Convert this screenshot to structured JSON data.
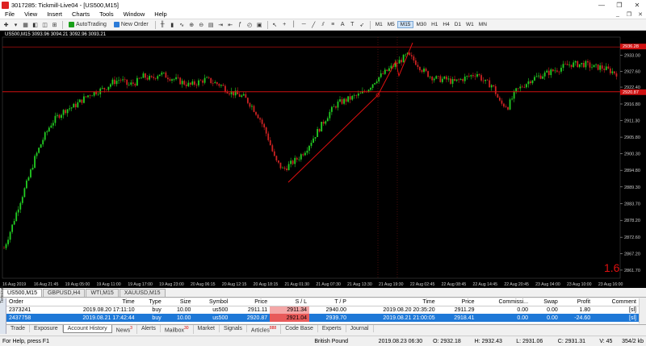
{
  "titlebar": {
    "title": "3017285: Tickmill-Live04 - [US500,M15]",
    "minimize": "—",
    "restore": "❐",
    "close": "✕"
  },
  "menu": {
    "items": [
      "File",
      "View",
      "Insert",
      "Charts",
      "Tools",
      "Window",
      "Help"
    ],
    "mdi": [
      "_",
      "❐",
      "✕"
    ]
  },
  "toolbar": {
    "autotrading": "AutoTrading",
    "neworder": "New Order",
    "timeframes": [
      "M1",
      "M5",
      "M15",
      "M30",
      "H1",
      "H4",
      "D1",
      "W1",
      "MN"
    ],
    "active_tf": "M15",
    "colors": {
      "autotrading": "#1aa01a",
      "neworder": "#2b7bd8"
    }
  },
  "chart": {
    "symbol_info": "US500,M15  3093.96 3094.21 3092.96 3093.21",
    "big_label": "1.6",
    "price_top": "2936.28",
    "price_line": "2920.87",
    "bg": "#000000",
    "bull": "#22cc22",
    "bear": "#cc2222",
    "chart_data": {
      "type": "line",
      "y_ticks": [
        "2933.00",
        "2927.60",
        "2922.40",
        "2916.80",
        "2911.30",
        "2905.80",
        "2900.30",
        "2894.80",
        "2889.30",
        "2883.70",
        "2878.20",
        "2872.60",
        "2867.20",
        "2861.70"
      ],
      "x_ticks": [
        "16 Aug 2019",
        "16 Aug 21:45",
        "19 Aug 05:00",
        "19 Aug 11:00",
        "19 Aug 17:00",
        "19 Aug 23:00",
        "20 Aug 06:15",
        "20 Aug 12:15",
        "20 Aug 18:15",
        "21 Aug 01:30",
        "21 Aug 07:30",
        "21 Aug 13:30",
        "21 Aug 19:30",
        "22 Aug 02:45",
        "22 Aug 08:45",
        "22 Aug 14:45",
        "22 Aug 20:45",
        "23 Aug 04:00",
        "23 Aug 10:00",
        "23 Aug 16:00"
      ],
      "ylim": [
        2859,
        2939
      ],
      "close_prices": [
        2869,
        2876,
        2884,
        2891,
        2899,
        2905,
        2910,
        2913,
        2915,
        2916,
        2918,
        2920,
        2921,
        2922,
        2924,
        2925,
        2923,
        2924,
        2926,
        2925,
        2927,
        2926,
        2925,
        2924,
        2923,
        2924,
        2925,
        2924,
        2923,
        2921,
        2920,
        2919,
        2916,
        2912,
        2906,
        2898,
        2895,
        2897,
        2899,
        2902,
        2906,
        2910,
        2914,
        2917,
        2918,
        2919,
        2920,
        2922,
        2925,
        2927,
        2929,
        2931,
        2933,
        2931,
        2928,
        2926,
        2925,
        2925,
        2924,
        2925,
        2926,
        2927,
        2924,
        2923,
        2917,
        2916,
        2921,
        2923,
        2925,
        2926,
        2927,
        2928,
        2929,
        2930,
        2930,
        2930,
        2929,
        2929,
        2928,
        2927
      ]
    }
  },
  "chart_tabs": {
    "items": [
      "US500,M15",
      "GBPUSD,H4",
      "WTI,M15",
      "XAUUSD,M15"
    ],
    "active": 0
  },
  "terminal": {
    "side_label": "Terminal",
    "columns": [
      "Order",
      "Time",
      "Type",
      "Size",
      "Symbol",
      "Price",
      "S / L",
      "T / P",
      "Time",
      "Price",
      "Commissi...",
      "Swap",
      "Profit",
      "Comment"
    ],
    "rows": [
      [
        "2373241",
        "2019.08.20 17:11:10",
        "buy",
        "10.00",
        "us500",
        "2911.11",
        "2911.34",
        "2940.00",
        "2019.08.20 20:35:20",
        "2911.29",
        "0.00",
        "0.00",
        "1.80",
        "[sl]"
      ],
      [
        "2437758",
        "2019.08.21 17:42:44",
        "buy",
        "10.00",
        "us500",
        "2920.87",
        "2921.04",
        "2939.70",
        "2019.08.21 21:00:05",
        "2918.41",
        "0.00",
        "0.00",
        "-24.60",
        "[sl]"
      ]
    ]
  },
  "term_tabs": [
    {
      "label": "Trade",
      "badge": ""
    },
    {
      "label": "Exposure",
      "badge": ""
    },
    {
      "label": "Account History",
      "badge": ""
    },
    {
      "label": "News",
      "badge": "3"
    },
    {
      "label": "Alerts",
      "badge": ""
    },
    {
      "label": "Mailbox",
      "badge": "30"
    },
    {
      "label": "Market",
      "badge": ""
    },
    {
      "label": "Signals",
      "badge": ""
    },
    {
      "label": "Articles",
      "badge": "888"
    },
    {
      "label": "Code Base",
      "badge": ""
    },
    {
      "label": "Experts",
      "badge": ""
    },
    {
      "label": "Journal",
      "badge": ""
    }
  ],
  "term_active": 2,
  "status": {
    "help": "For Help, press F1",
    "profile": "British Pound",
    "datetime": "2019.08.23 06:30",
    "open": "O: 2932.18",
    "high": "H: 2932.43",
    "low": "L: 2931.06",
    "close": "C: 2931.31",
    "volume": "V: 45",
    "traffic": "354/2 kb"
  }
}
